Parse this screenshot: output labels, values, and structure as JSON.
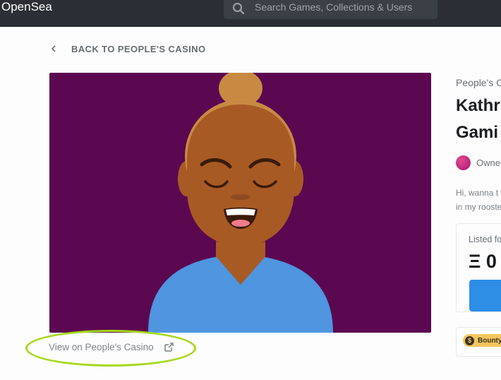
{
  "header": {
    "brand": "OpenSea",
    "search": {
      "placeholder": "Search Games, Collections & Users"
    }
  },
  "nav": {
    "back_label": "BACK TO PEOPLE'S CASINO"
  },
  "asset": {
    "view_link_label": "View on People's Casino",
    "collection": "People's C",
    "title_line1": "Kathr",
    "title_line2": "Gami",
    "owner_label": "Ownec",
    "description_line1": "Hi, wanna t",
    "description_line2": "in my rooste"
  },
  "listing": {
    "label": "Listed fo",
    "price": "Ξ 0"
  },
  "badge": {
    "label": "Bounty"
  },
  "colors": {
    "topbar": "#2b2f35",
    "art_background": "#5b0851",
    "buy_button": "#2e8ee5",
    "highlight": "#a5d81b",
    "bounty_badge": "#f3c55d"
  },
  "icons": [
    "search-icon",
    "chevron-left-icon",
    "external-link-icon",
    "coin-icon"
  ]
}
